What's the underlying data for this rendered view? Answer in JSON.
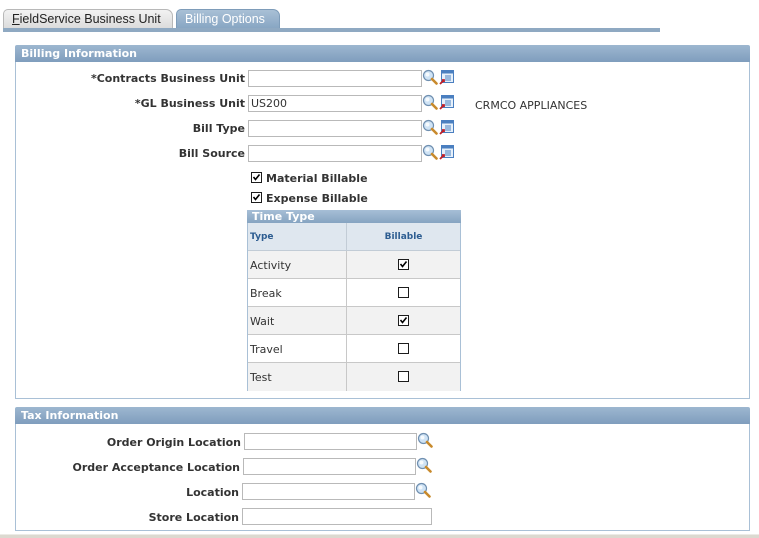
{
  "tabs": [
    {
      "label_accel": "F",
      "label_rest": "ieldService Business Unit",
      "active": false
    },
    {
      "label": "Billing Options",
      "active": true
    }
  ],
  "billing": {
    "title": "Billing Information",
    "fields": [
      {
        "label": "*Contracts Business Unit",
        "value": "",
        "description": ""
      },
      {
        "label": "*GL Business Unit",
        "value": "US200",
        "description": "CRMCO APPLIANCES"
      },
      {
        "label": "Bill Type",
        "value": "",
        "description": ""
      },
      {
        "label": "Bill Source",
        "value": "",
        "description": ""
      }
    ],
    "checkboxes": [
      {
        "label": "Material Billable",
        "checked": true
      },
      {
        "label": "Expense Billable",
        "checked": true
      }
    ],
    "time_type": {
      "title": "Time Type",
      "columns": [
        "Type",
        "Billable"
      ],
      "rows": [
        {
          "type": "Activity",
          "billable": true
        },
        {
          "type": "Break",
          "billable": false
        },
        {
          "type": "Wait",
          "billable": true
        },
        {
          "type": "Travel",
          "billable": false
        },
        {
          "type": "Test",
          "billable": false
        }
      ]
    }
  },
  "tax": {
    "title": "Tax Information",
    "fields": [
      {
        "label": "Order Origin Location",
        "value": "",
        "lookup": true
      },
      {
        "label": "Order Acceptance Location",
        "value": "",
        "lookup": true
      },
      {
        "label": "Location",
        "value": "",
        "lookup": true
      },
      {
        "label": "Store Location",
        "value": "",
        "lookup": false
      }
    ]
  },
  "icons": {
    "lookup": "magnifier-lookup-icon",
    "detail": "prompt-detail-icon",
    "check": "checkmark"
  }
}
